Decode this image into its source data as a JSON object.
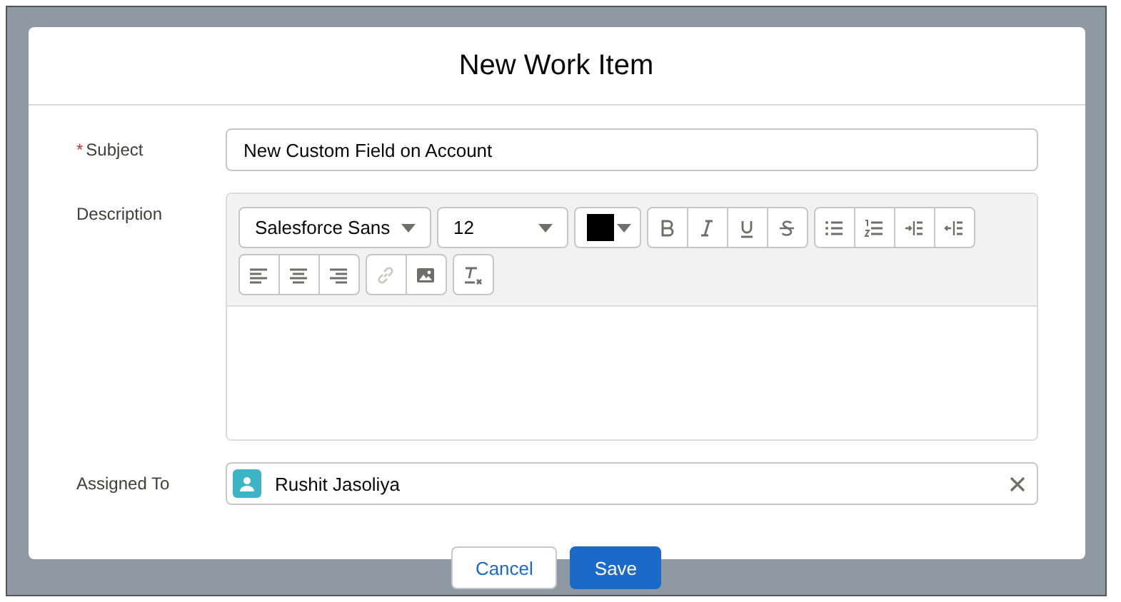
{
  "modal": {
    "title": "New Work Item"
  },
  "subject": {
    "label": "Subject",
    "required_mark": "*",
    "value": "New Custom Field on Account"
  },
  "description": {
    "label": "Description",
    "font": "Salesforce Sans",
    "size": "12",
    "color": "#000000",
    "toolbar_rows": [
      [
        [
          {
            "kind": "bold",
            "disabled": false
          },
          {
            "kind": "italic",
            "disabled": false
          },
          {
            "kind": "underline",
            "disabled": false
          },
          {
            "kind": "strike",
            "disabled": false
          }
        ],
        [
          {
            "kind": "bullets",
            "disabled": false
          },
          {
            "kind": "numbers",
            "disabled": false
          },
          {
            "kind": "indent",
            "disabled": false
          },
          {
            "kind": "outdent",
            "disabled": false
          }
        ]
      ],
      [
        [
          {
            "kind": "align-left",
            "disabled": false
          },
          {
            "kind": "align-center",
            "disabled": false
          },
          {
            "kind": "align-right",
            "disabled": false
          }
        ],
        [
          {
            "kind": "link",
            "disabled": true
          },
          {
            "kind": "image",
            "disabled": false
          }
        ],
        [
          {
            "kind": "clear",
            "disabled": false
          }
        ]
      ]
    ]
  },
  "assigned": {
    "label": "Assigned To",
    "value": "Rushit Jasoliya"
  },
  "buttons": [
    {
      "label": "Cancel",
      "kind": "neutral"
    },
    {
      "label": "Save",
      "kind": "brand"
    }
  ]
}
